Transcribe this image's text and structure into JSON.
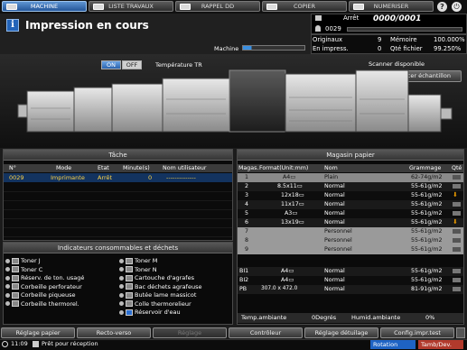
{
  "tabs": [
    "MACHINE",
    "LISTE TRAVAUX",
    "RAPPEL DD",
    "COPIER",
    "NUMERISER"
  ],
  "header": {
    "title": "Impression en cours",
    "status_label": "Arrêt",
    "status_value": "0000/0001",
    "job_number": "0029",
    "originals_label": "Originaux",
    "originals_value": "9",
    "memory_label": "Mémoire",
    "memory_value": "100.000%",
    "in_print_label": "En impress.",
    "in_print_value": "0",
    "file_qty_label": "Qté fichier",
    "file_qty_value": "99.250%",
    "machine_label": "Machine"
  },
  "machine_view": {
    "on_label": "ON",
    "off_label": "OFF",
    "temp_label": "Température TR",
    "scanner_label": "Scanner disponible",
    "launch_button": "Lancer échantillon"
  },
  "tache": {
    "title": "Tâche",
    "columns": [
      "N°",
      "Mode",
      "Etat",
      "Minute(s)",
      "Nom utilisateur"
    ],
    "rows": [
      [
        "0029",
        "Imprimante",
        "Arrêt",
        "0",
        "--------------"
      ]
    ]
  },
  "consumables": {
    "title": "Indicateurs consommables et déchets",
    "left": [
      "Toner J",
      "Toner C",
      "Réserv. de ton. usagé",
      "Corbeille perforateur",
      "Corbeille piqueuse",
      "Corbeille thermorel."
    ],
    "right": [
      "Toner M",
      "Toner N",
      "Cartouche d'agrafes",
      "Bac déchets agrafeuse",
      "Butée lame massicot",
      "Colle thermorelieur",
      "Réservoir d'eau"
    ]
  },
  "magasin": {
    "title": "Magasin papier",
    "columns": [
      "Magas.",
      "Format(Unit:mm)",
      "Nom",
      "Grammage",
      "Qté"
    ],
    "rows": [
      [
        "1",
        "A4▭",
        "Plain",
        "62-74g/m2"
      ],
      [
        "2",
        "8.5x11▭",
        "Normal",
        "55-61g/m2"
      ],
      [
        "3",
        "12x18▭",
        "Normal",
        "55-61g/m2"
      ],
      [
        "4",
        "11x17▭",
        "Normal",
        "55-61g/m2"
      ],
      [
        "5",
        "A3▭",
        "Normal",
        "55-61g/m2"
      ],
      [
        "6",
        "13x19▭",
        "Normal",
        "55-61g/m2"
      ],
      [
        "7",
        "",
        "Personnel",
        "55-61g/m2"
      ],
      [
        "8",
        "",
        "Personnel",
        "55-61g/m2"
      ],
      [
        "9",
        "",
        "Personnel",
        "55-61g/m2"
      ]
    ],
    "bypass_rows": [
      [
        "BI1",
        "A4▭",
        "Normal",
        "55-61g/m2"
      ],
      [
        "BI2",
        "A4▭",
        "Normal",
        "55-61g/m2"
      ],
      [
        "PB",
        "307.0 x 472.0",
        "Normal",
        "81-91g/m2"
      ]
    ],
    "temp_label": "Temp.ambiante",
    "temp_value": "0Degrés",
    "humid_label": "Humid.ambiante",
    "humid_value": "0%"
  },
  "bottom_buttons": [
    "Réglage papier",
    "Recto-verso",
    "Réglage",
    "Contrôleur",
    "Réglage détuilage",
    "Config.impr.test"
  ],
  "status_bar": {
    "time": "11:09",
    "message": "Prêt pour réception",
    "rotation": "Rotation",
    "tamb": "Tamb/Dev."
  },
  "colors": {
    "accent": "#2f6fbf",
    "warn": "#e39600",
    "status_blue": "#1e63c4"
  }
}
